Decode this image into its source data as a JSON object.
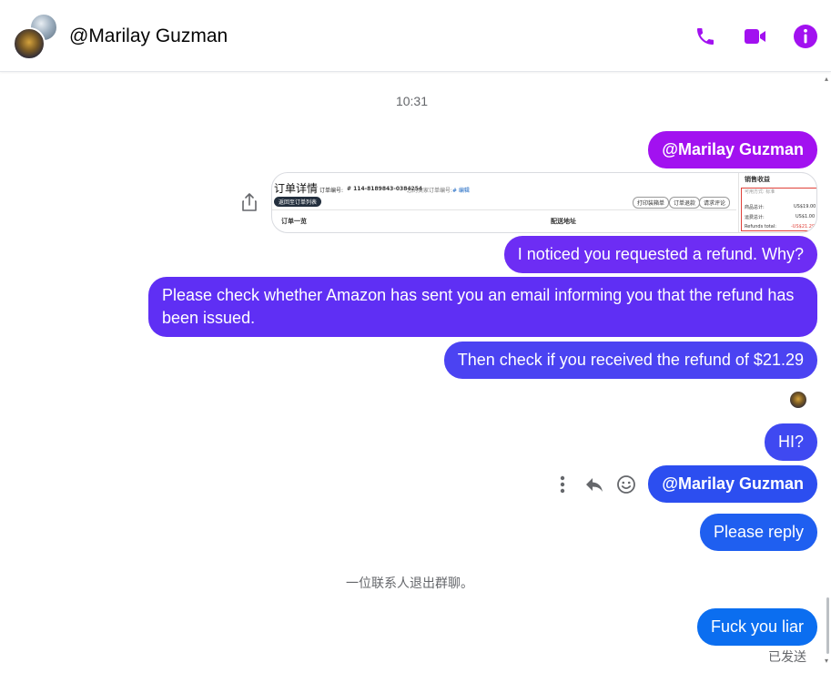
{
  "header": {
    "title": "@Marilay Guzman",
    "icons": [
      "phone-icon",
      "video-icon",
      "info-icon"
    ]
  },
  "colors": {
    "purple": "#a211f0",
    "violet": "#6d2df4",
    "indigo": "#4b43f2",
    "blue": "#2c4ef0",
    "blue2": "#1f5ff0",
    "blue3": "#0b6ef0"
  },
  "chat": {
    "timestamp": "10:31",
    "messages": [
      {
        "text": "@Marilay Guzman"
      },
      {
        "text": "I noticed you requested a refund. Why?"
      },
      {
        "text": "Please check whether Amazon has sent you an email informing you that the refund has been issued."
      },
      {
        "text": "Then check if you received the refund of $21.29"
      },
      {
        "text": "HI?"
      },
      {
        "text": "@Marilay Guzman"
      },
      {
        "text": "Please reply"
      },
      {
        "text": "Fuck you liar"
      }
    ],
    "image": {
      "title": "订单详情",
      "order_label": "订单编号:",
      "order_number": "# 114-8189843-0384254",
      "alt_label": "您的卖家订单编号:",
      "edit": "# 编辑",
      "back_button": "返回至订单列表",
      "btn_print": "打印装箱单",
      "btn_refund": "订单退款",
      "btn_review": "请求评论",
      "section_summary": "订单一览",
      "section_address": "配送地址",
      "panel_title": "销售收益",
      "panel_sub": "可用方式: 标准",
      "row1_label": "商品总计:",
      "row1_value": "US$19.00",
      "row2_label": "运费总计:",
      "row2_value": "US$1.00",
      "row3_label": "Refunds total:",
      "row3_value": "-US$21.29"
    },
    "system_message": "一位联系人退出群聊。",
    "sent_status": "已发送"
  }
}
